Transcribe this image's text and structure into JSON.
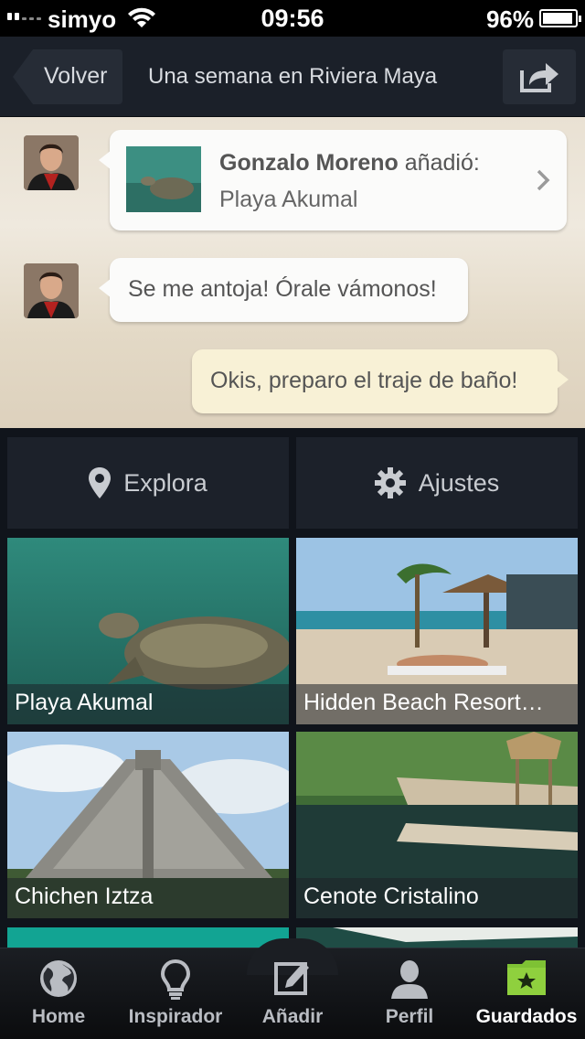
{
  "status_bar": {
    "carrier": "simyo",
    "time": "09:56",
    "battery": "96%"
  },
  "nav": {
    "back_label": "Volver",
    "title": "Una semana en Riviera Maya"
  },
  "chat": {
    "message1": {
      "author": "Gonzalo Moreno",
      "action": "añadió:",
      "place": "Playa Akumal"
    },
    "message2": {
      "text": "Se me antoja! Órale vámonos!"
    },
    "message3": {
      "text": "Okis, preparo el traje de baño!"
    }
  },
  "actions": {
    "explore_label": "Explora",
    "settings_label": "Ajustes"
  },
  "places": [
    {
      "name": "Playa Akumal"
    },
    {
      "name": "Hidden Beach Resort…"
    },
    {
      "name": "Chichen Iztza"
    },
    {
      "name": "Cenote Cristalino"
    }
  ],
  "tabs": [
    {
      "label": "Home",
      "icon": "globe-icon"
    },
    {
      "label": "Inspirador",
      "icon": "lightbulb-icon"
    },
    {
      "label": "Añadir",
      "icon": "edit-icon"
    },
    {
      "label": "Perfil",
      "icon": "person-icon"
    },
    {
      "label": "Guardados",
      "icon": "folder-star-icon"
    }
  ],
  "colors": {
    "active_tab_icon": "#7ec234",
    "bar_background": "#1b2029"
  }
}
